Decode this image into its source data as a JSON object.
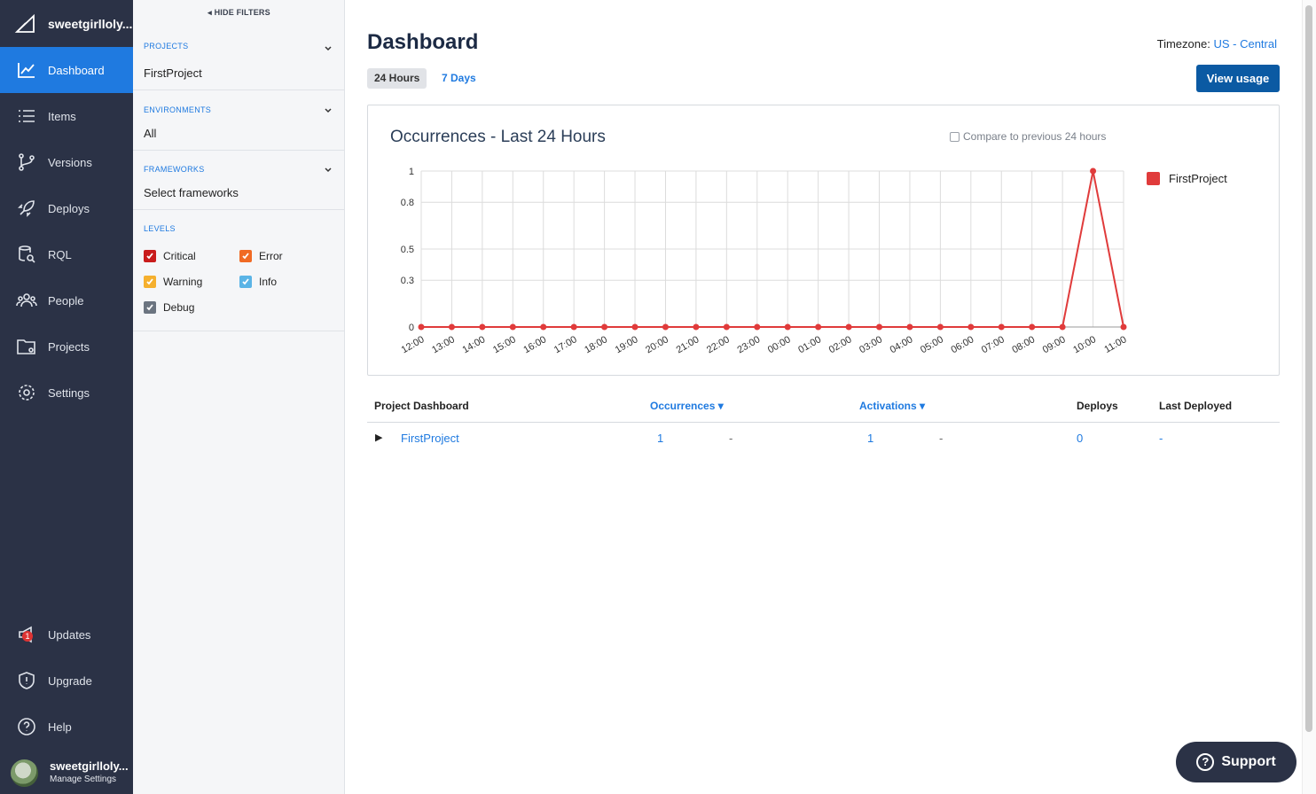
{
  "nav": {
    "account": "sweetgirlloly...",
    "items": [
      {
        "label": "Dashboard",
        "icon": "chart-line-icon"
      },
      {
        "label": "Items",
        "icon": "list-icon"
      },
      {
        "label": "Versions",
        "icon": "branch-icon"
      },
      {
        "label": "Deploys",
        "icon": "rocket-icon"
      },
      {
        "label": "RQL",
        "icon": "database-search-icon"
      },
      {
        "label": "People",
        "icon": "people-icon"
      },
      {
        "label": "Projects",
        "icon": "folder-icon"
      },
      {
        "label": "Settings",
        "icon": "gear-icon"
      }
    ],
    "bottom": [
      {
        "label": "Updates",
        "icon": "megaphone-icon",
        "badge": "1"
      },
      {
        "label": "Upgrade",
        "icon": "shield-icon"
      },
      {
        "label": "Help",
        "icon": "help-icon"
      }
    ],
    "user": {
      "name": "sweetgirlloly...",
      "sub": "Manage Settings"
    }
  },
  "filters": {
    "hide_label": "HIDE FILTERS",
    "projects": {
      "title": "PROJECTS",
      "value": "FirstProject"
    },
    "environments": {
      "title": "ENVIRONMENTS",
      "value": "All"
    },
    "frameworks": {
      "title": "FRAMEWORKS",
      "value": "Select frameworks"
    },
    "levels": {
      "title": "LEVELS",
      "items": [
        {
          "label": "Critical",
          "color": "#c91c1c",
          "checked": true
        },
        {
          "label": "Error",
          "color": "#f06a24",
          "checked": true
        },
        {
          "label": "Warning",
          "color": "#f5b02e",
          "checked": true
        },
        {
          "label": "Info",
          "color": "#5ab4e6",
          "checked": true
        },
        {
          "label": "Debug",
          "color": "#6b7480",
          "checked": true
        }
      ]
    }
  },
  "main": {
    "title": "Dashboard",
    "timezone_label": "Timezone:",
    "timezone_value": "US - Central",
    "tabs": [
      "24 Hours",
      "7 Days"
    ],
    "view_usage": "View usage",
    "compare_label": "Compare to previous 24 hours"
  },
  "chart_data": {
    "type": "line",
    "title": "Occurrences - Last 24 Hours",
    "x": [
      "12:00",
      "13:00",
      "14:00",
      "15:00",
      "16:00",
      "17:00",
      "18:00",
      "19:00",
      "20:00",
      "21:00",
      "22:00",
      "23:00",
      "00:00",
      "01:00",
      "02:00",
      "03:00",
      "04:00",
      "05:00",
      "06:00",
      "07:00",
      "08:00",
      "09:00",
      "10:00",
      "11:00"
    ],
    "series": [
      {
        "name": "FirstProject",
        "color": "#e03b3b",
        "values": [
          0,
          0,
          0,
          0,
          0,
          0,
          0,
          0,
          0,
          0,
          0,
          0,
          0,
          0,
          0,
          0,
          0,
          0,
          0,
          0,
          0,
          0,
          1,
          0
        ]
      }
    ],
    "ylim": [
      0,
      1
    ],
    "yticks": [
      "0",
      "0.3",
      "0.5",
      "0.8",
      "1"
    ],
    "grid": true,
    "legend": "right"
  },
  "table": {
    "headers": {
      "project": "Project Dashboard",
      "occurrences": "Occurrences ▾",
      "activations": "Activations ▾",
      "deploys": "Deploys",
      "last_deployed": "Last Deployed"
    },
    "rows": [
      {
        "name": "FirstProject",
        "occurrences": "1",
        "occ_delta": "-",
        "activations": "1",
        "act_delta": "-",
        "deploys": "0",
        "last_deployed": "-"
      }
    ]
  },
  "support": "Support"
}
